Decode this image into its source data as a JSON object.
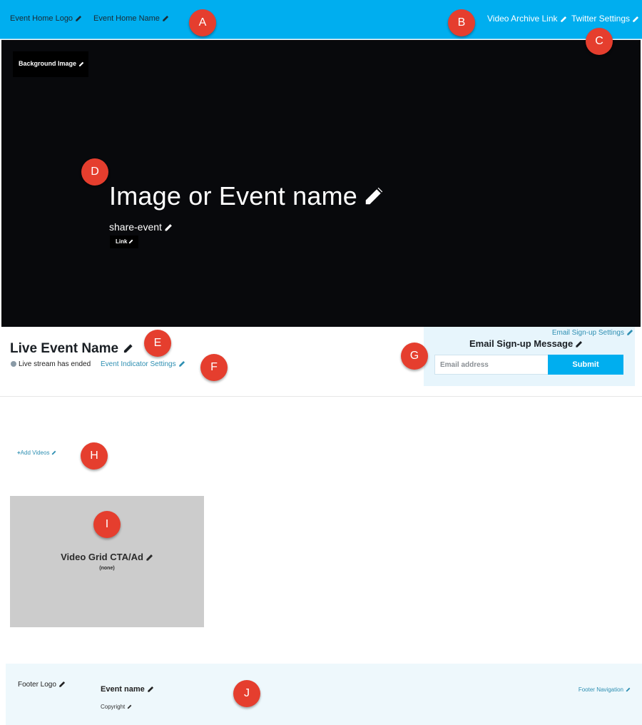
{
  "header": {
    "logo_label": "Event Home Logo",
    "name_label": "Event Home Name",
    "archive_label": "Video Archive Link",
    "twitter_label": "Twitter Settings"
  },
  "hero": {
    "background_label": "Background Image",
    "title": "Image or Event name",
    "share_label": "share-event",
    "link_label": "Link"
  },
  "live_event": {
    "name": "Live Event Name",
    "status": "Live stream has ended",
    "indicator_settings": "Event Indicator Settings"
  },
  "email_signup": {
    "settings_label": "Email Sign-up Settings",
    "message": "Email Sign-up Message",
    "email_placeholder": "Email address",
    "submit_label": "Submit"
  },
  "videos": {
    "add_label": "Add Videos",
    "add_symbol": "+"
  },
  "video_grid": {
    "cta_title": "Video Grid CTA/Ad",
    "cta_value": "(none)"
  },
  "footer": {
    "logo_label": "Footer Logo",
    "event_name": "Event name",
    "copyright_label": "Copyright",
    "nav_label": "Footer Navigation"
  },
  "callouts": [
    "A",
    "B",
    "C",
    "D",
    "E",
    "F",
    "G",
    "H",
    "I",
    "J"
  ],
  "colors": {
    "header_bg": "#00aeef",
    "hero_bg": "#08090c",
    "link": "#2e8fb2",
    "badge": "#e53e2e",
    "signup_bg": "#e7f5fc",
    "tile_bg": "#cccccc",
    "footer_bg": "#eef8fc"
  },
  "icons": {
    "edit": "pencil-icon",
    "status": "status-dot-icon",
    "add": "plus-icon"
  }
}
